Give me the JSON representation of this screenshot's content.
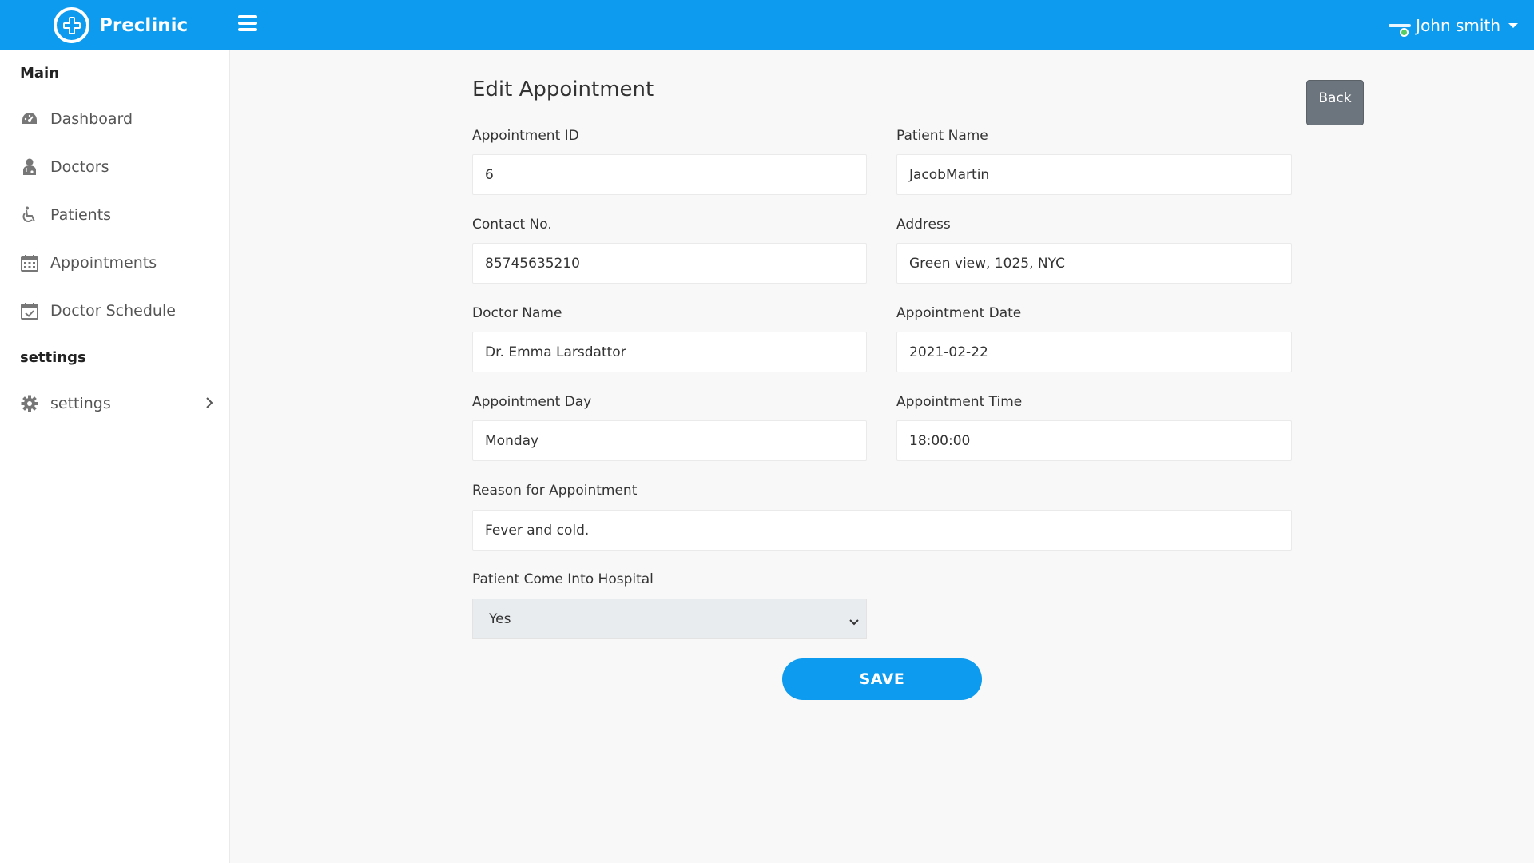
{
  "header": {
    "brand": "Preclinic",
    "user_name": "John smith",
    "colors": {
      "primary": "#0c9bef",
      "online": "#55ce63"
    }
  },
  "sidebar": {
    "section_main": "Main",
    "items": [
      {
        "label": "Dashboard",
        "icon": "dashboard-icon"
      },
      {
        "label": "Doctors",
        "icon": "doctor-icon"
      },
      {
        "label": "Patients",
        "icon": "wheelchair-icon"
      },
      {
        "label": "Appointments",
        "icon": "calendar-icon"
      },
      {
        "label": "Doctor Schedule",
        "icon": "calendar-check-icon"
      }
    ],
    "section_settings": "settings",
    "settings_item": {
      "label": "settings",
      "icon": "gear-icon"
    }
  },
  "page": {
    "title": "Edit Appointment",
    "back_label": "Back",
    "save_label": "SAVE"
  },
  "form": {
    "appointment_id": {
      "label": "Appointment ID",
      "value": "6"
    },
    "patient_name": {
      "label": "Patient Name",
      "value": "JacobMartin"
    },
    "contact_no": {
      "label": "Contact No.",
      "value": "85745635210"
    },
    "address": {
      "label": "Address",
      "value": "Green view, 1025, NYC"
    },
    "doctor_name": {
      "label": "Doctor Name",
      "value": "Dr. Emma Larsdattor"
    },
    "appointment_date": {
      "label": "Appointment Date",
      "value": "2021-02-22"
    },
    "appointment_day": {
      "label": "Appointment Day",
      "value": "Monday"
    },
    "appointment_time": {
      "label": "Appointment Time",
      "value": "18:00:00"
    },
    "reason": {
      "label": "Reason for Appointment",
      "value": "Fever and cold."
    },
    "came_to_hospital": {
      "label": "Patient Come Into Hospital",
      "value": "Yes"
    }
  }
}
